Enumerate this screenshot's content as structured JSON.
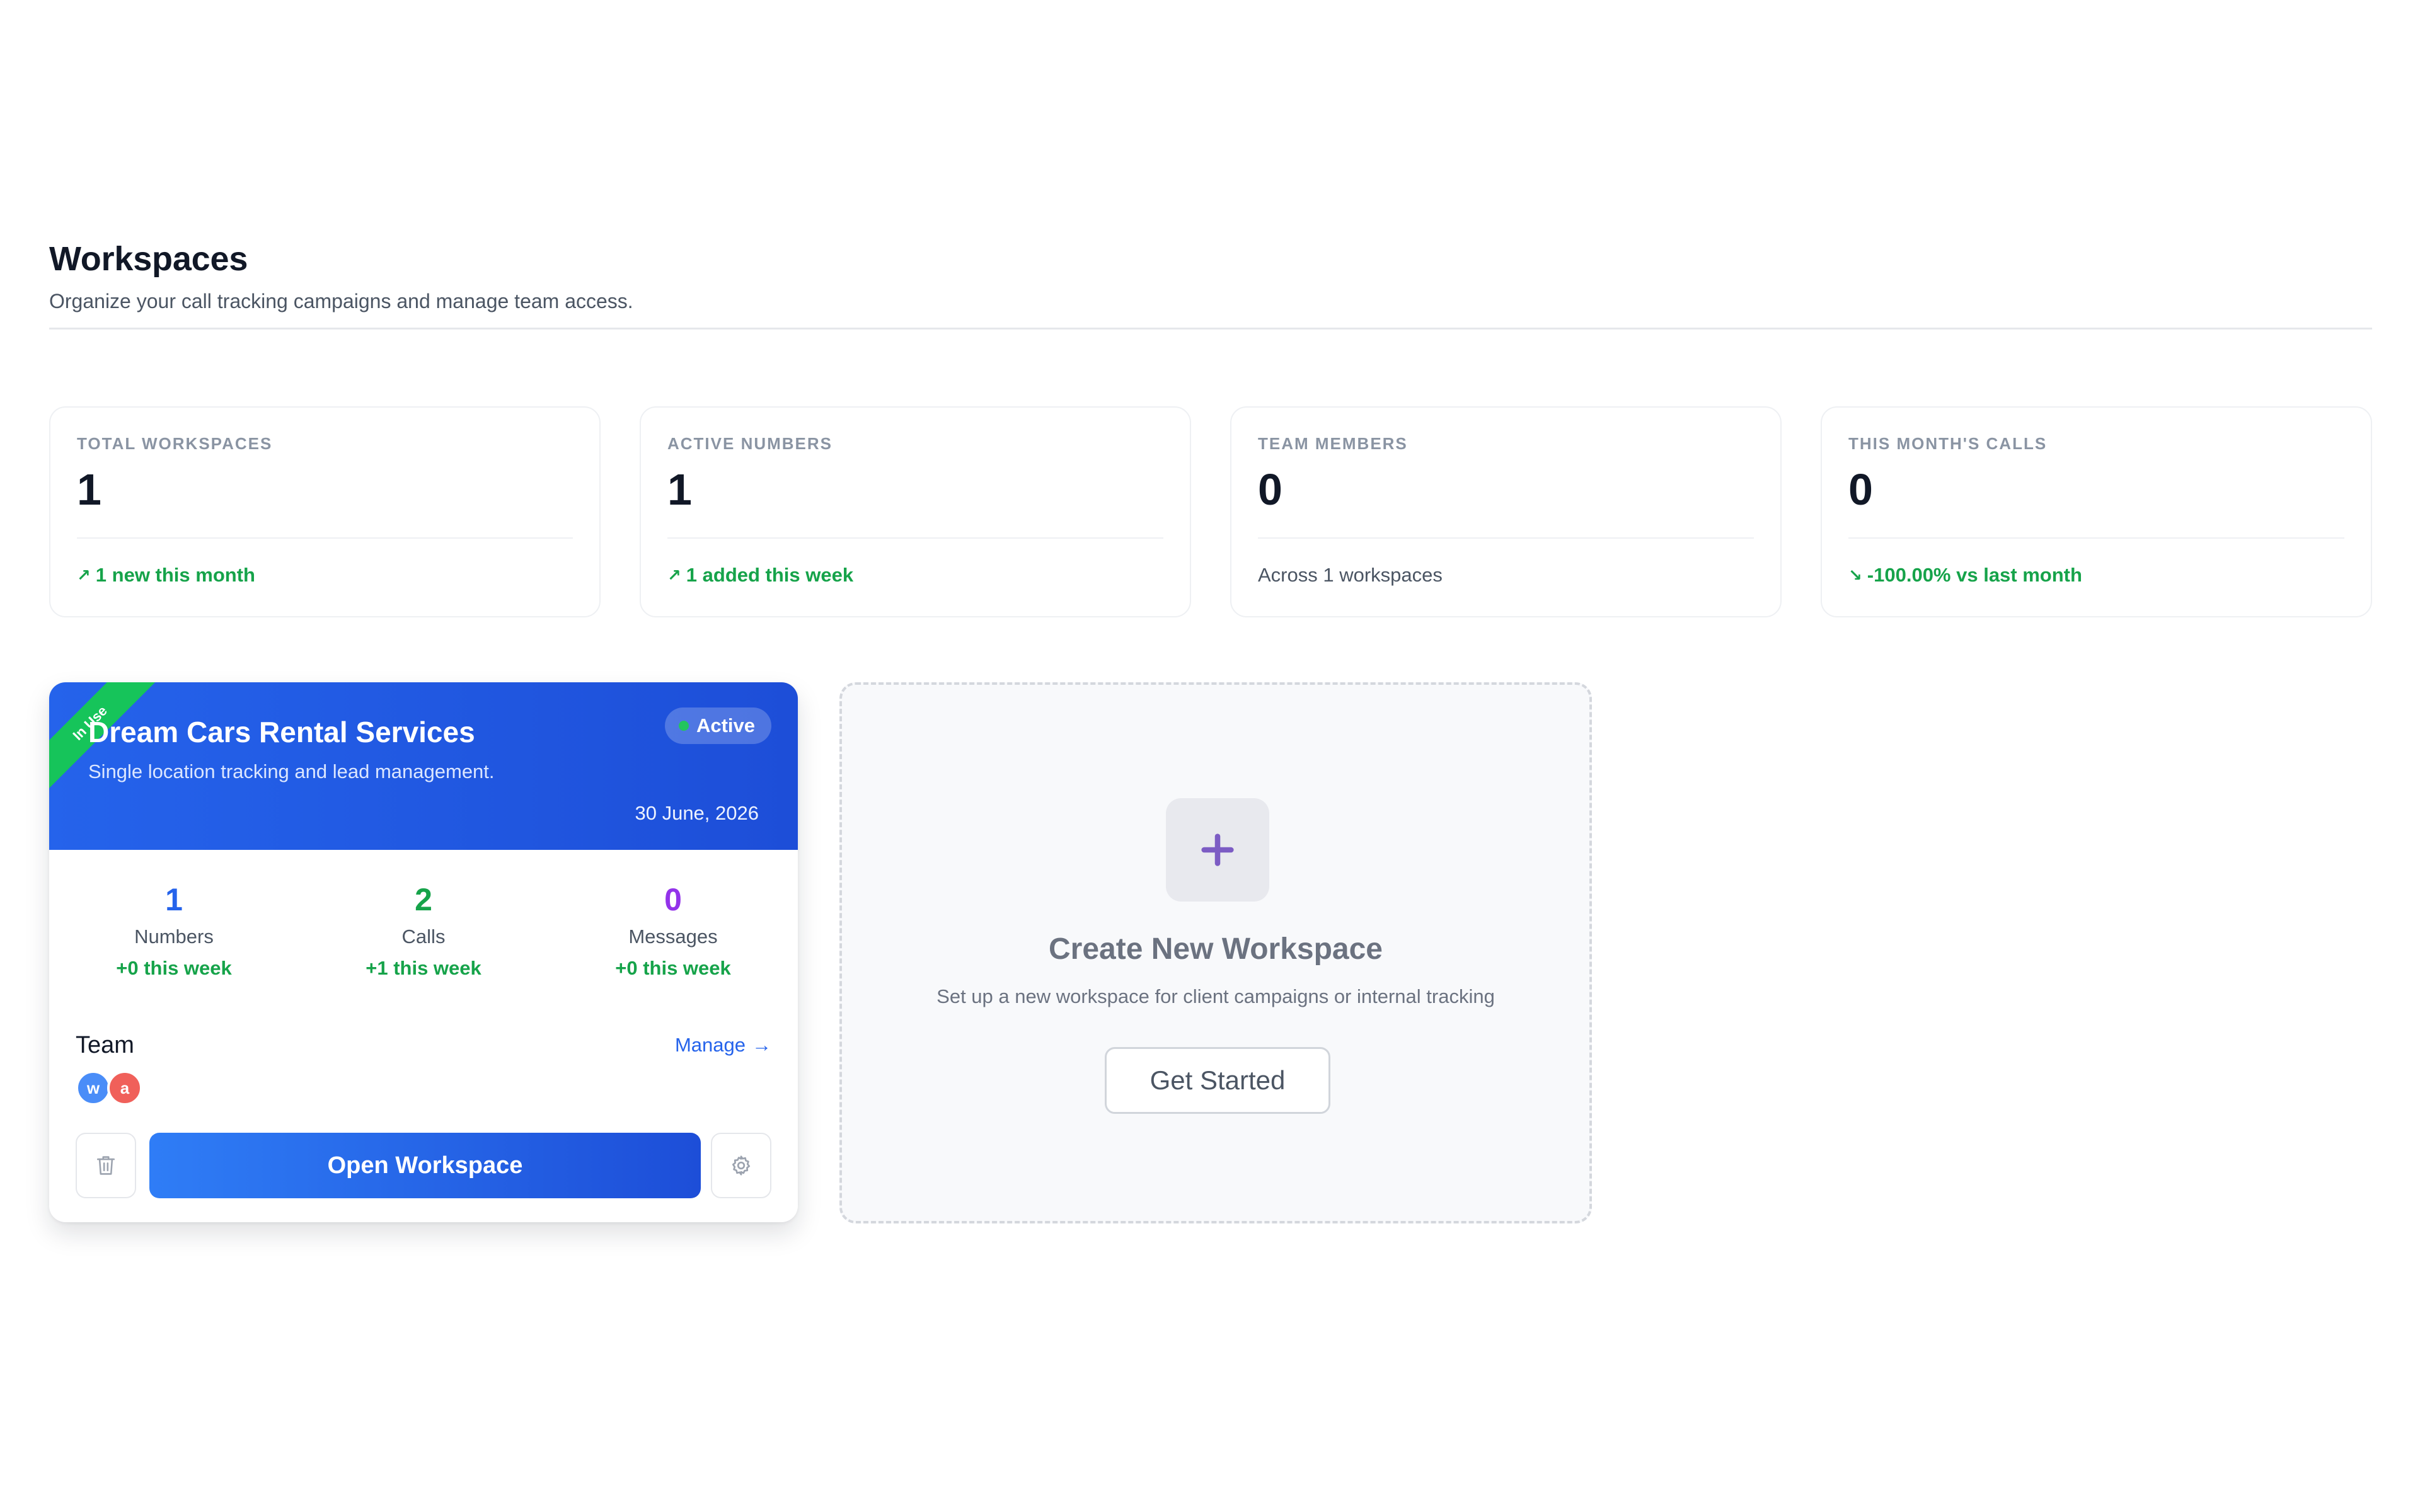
{
  "header": {
    "title": "Workspaces",
    "subtitle": "Organize your call tracking campaigns and manage team access."
  },
  "stats": [
    {
      "label": "TOTAL WORKSPACES",
      "value": "1",
      "foot": "1 new this month",
      "trend": "up"
    },
    {
      "label": "ACTIVE NUMBERS",
      "value": "1",
      "foot": "1 added this week",
      "trend": "up"
    },
    {
      "label": "TEAM MEMBERS",
      "value": "0",
      "foot": "Across 1 workspaces",
      "trend": "none"
    },
    {
      "label": "THIS MONTH'S CALLS",
      "value": "0",
      "foot": "-100.00% vs last month",
      "trend": "down"
    }
  ],
  "icons": {
    "trend_up": "↗",
    "trend_down": "↘",
    "arrow_right": "→",
    "delete": "trash-icon",
    "settings": "gear-icon",
    "create": "plus-icon"
  },
  "workspace": {
    "ribbon": "In Use",
    "name": "Dream Cars Rental Services",
    "description": "Single location tracking and lead management.",
    "date": "30 June, 2026",
    "status": "Active",
    "metrics": [
      {
        "value": "1",
        "label": "Numbers",
        "delta": "+0 this week"
      },
      {
        "value": "2",
        "label": "Calls",
        "delta": "+1 this week"
      },
      {
        "value": "0",
        "label": "Messages",
        "delta": "+0 this week"
      }
    ],
    "team_title": "Team",
    "manage_label": "Manage",
    "avatars": [
      {
        "initial": "w",
        "color": "#4a8df8"
      },
      {
        "initial": "a",
        "color": "#f0605a"
      }
    ],
    "open_label": "Open Workspace"
  },
  "create": {
    "title": "Create New Workspace",
    "description": "Set up a new workspace for client campaigns or internal tracking",
    "button_label": "Get Started"
  },
  "colors": {
    "accent": "#2563eb",
    "success": "#16a34a",
    "purple": "#9333ea",
    "ribbon": "#16c45a",
    "plus": "#7c5cc4"
  }
}
